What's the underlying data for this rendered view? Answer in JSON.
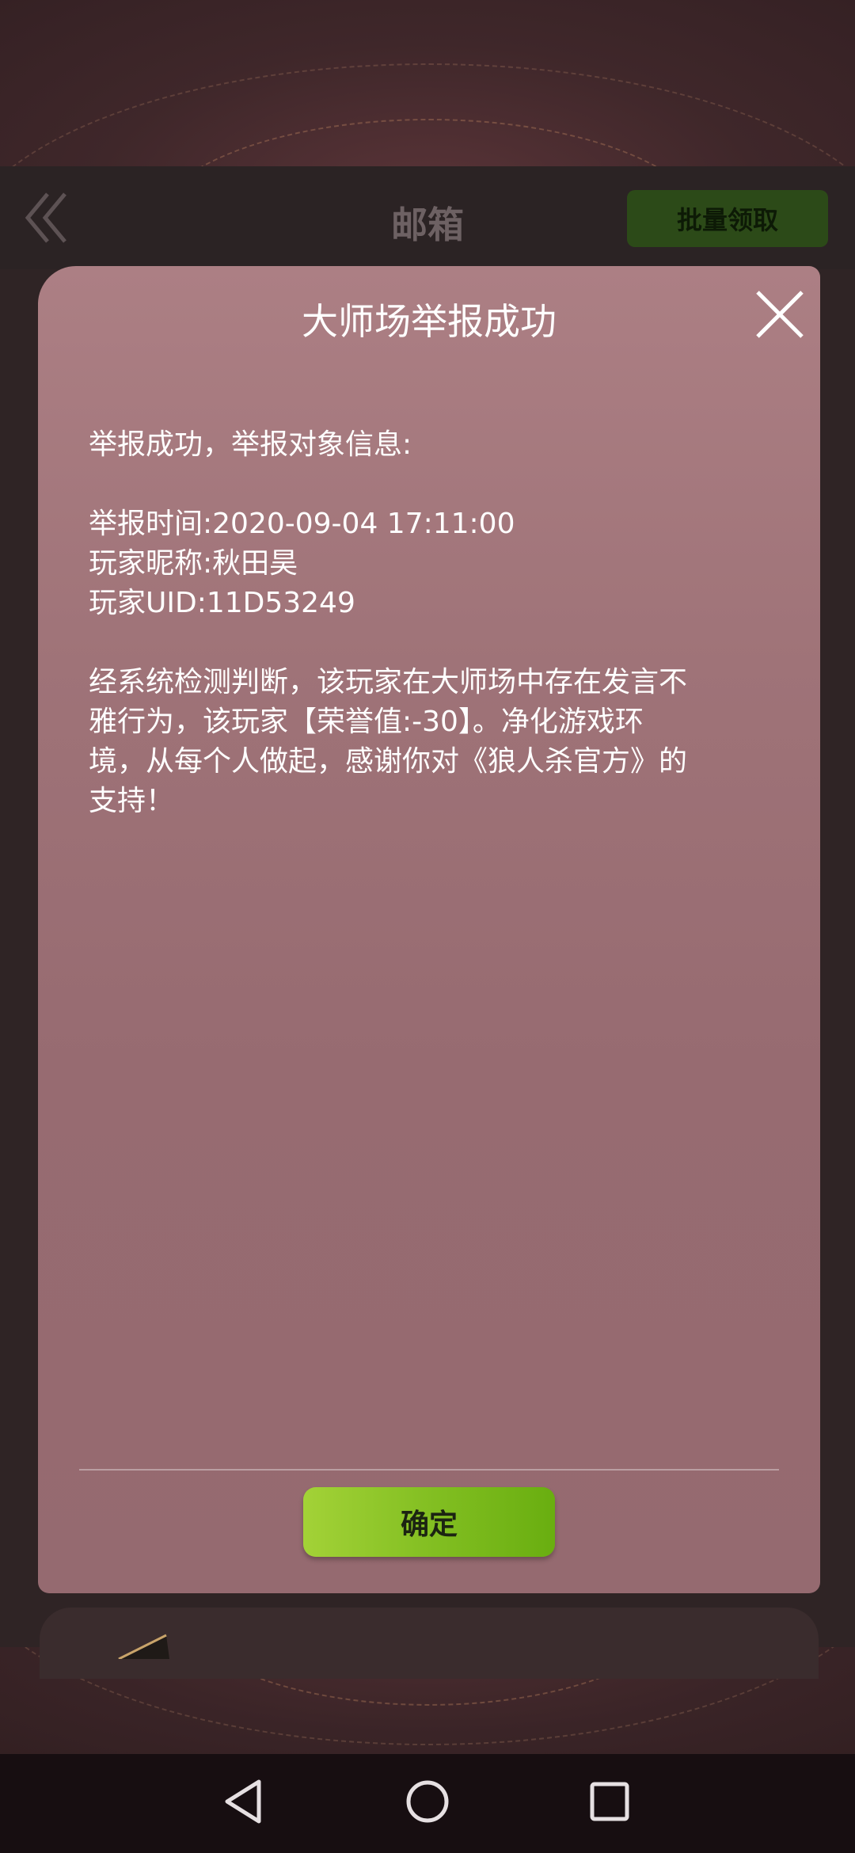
{
  "header": {
    "title": "邮箱",
    "batch_claim_label": "批量领取"
  },
  "dialog": {
    "title": "大师场举报成功",
    "intro": "举报成功，举报对象信息:",
    "report_time": "举报时间:2020-09-04 17:11:00",
    "nickname": "玩家昵称:秋田昊",
    "uid": "玩家UID:11D53249",
    "message_lines": [
      "经系统检测判断，该玩家在大师场中存在发言不",
      "雅行为，该玩家【荣誉值:-30】。净化游戏环",
      "境，从每个人做起，感谢你对《狼人杀官方》的",
      "支持！"
    ],
    "confirm_label": "确定"
  },
  "icons": {
    "back": "double-chevron-left-icon",
    "close": "close-icon",
    "mail": "mail-envelope-icon",
    "nav_back": "triangle-back-icon",
    "nav_home": "circle-home-icon",
    "nav_recent": "square-recents-icon"
  },
  "colors": {
    "dialog_bg": "#9f7378",
    "confirm_button": "#83bf22",
    "batch_button": "#2c4a18"
  }
}
